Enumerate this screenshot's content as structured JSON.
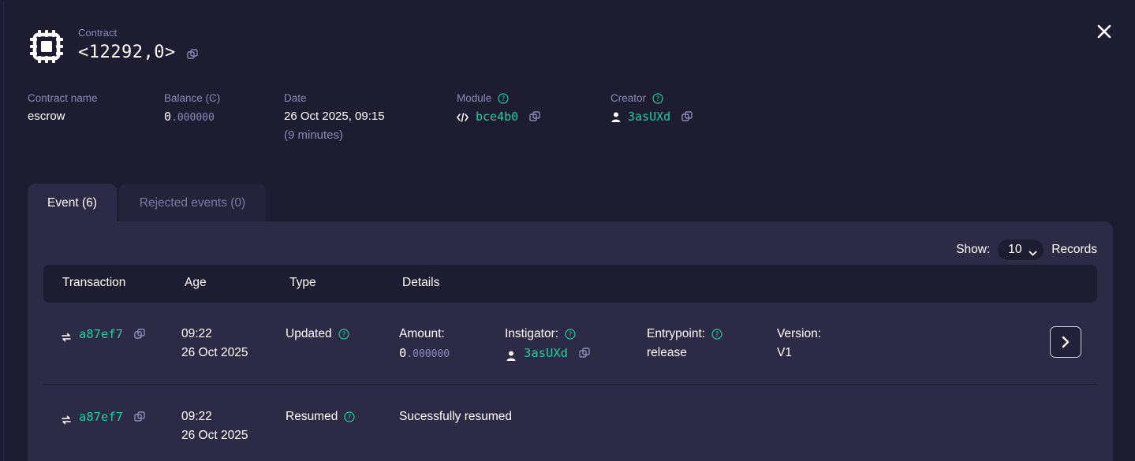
{
  "header": {
    "label": "Contract",
    "contract_id": "<12292,0>"
  },
  "info": {
    "contract_name": {
      "label": "Contract name",
      "value": "escrow"
    },
    "balance": {
      "label": "Balance (Ͼ)",
      "value_int": "0",
      "value_dec": ".000000"
    },
    "date": {
      "label": "Date",
      "value": "26 Oct 2025, 09:15",
      "relative": "(9 minutes)"
    },
    "module": {
      "label": "Module",
      "value": "bce4b0"
    },
    "creator": {
      "label": "Creator",
      "value": "3asUXd"
    }
  },
  "tabs": [
    {
      "label": "Event (6)"
    },
    {
      "label": "Rejected events (0)"
    }
  ],
  "pagination": {
    "show_label": "Show:",
    "selected": "10",
    "records_label": "Records"
  },
  "table": {
    "columns": [
      "Transaction",
      "Age",
      "Type",
      "Details"
    ],
    "rows": [
      {
        "tx": "a87ef7",
        "time": "09:22",
        "date": "26 Oct 2025",
        "type": "Updated",
        "amount_label": "Amount:",
        "amount_int": "0",
        "amount_dec": ".000000",
        "instigator_label": "Instigator:",
        "instigator": "3asUXd",
        "entrypoint_label": "Entrypoint:",
        "entrypoint": "release",
        "version_label": "Version:",
        "version": "V1"
      },
      {
        "tx": "a87ef7",
        "time": "09:22",
        "date": "26 Oct 2025",
        "type": "Resumed",
        "details": "Sucessfully resumed"
      }
    ]
  },
  "icons": {
    "contract": "cpu-chip-icon",
    "close": "close-icon",
    "copy": "copy-icon",
    "help": "help-circle-icon",
    "code": "code-icon",
    "user": "user-icon",
    "swap": "swap-icon",
    "chevron_right": "chevron-right-icon",
    "chevron_down": "chevron-down-icon"
  },
  "colors": {
    "background": "#1e1c30",
    "panel": "#2c2a45",
    "accent": "#1ecfa0",
    "muted": "#8d89b5"
  }
}
